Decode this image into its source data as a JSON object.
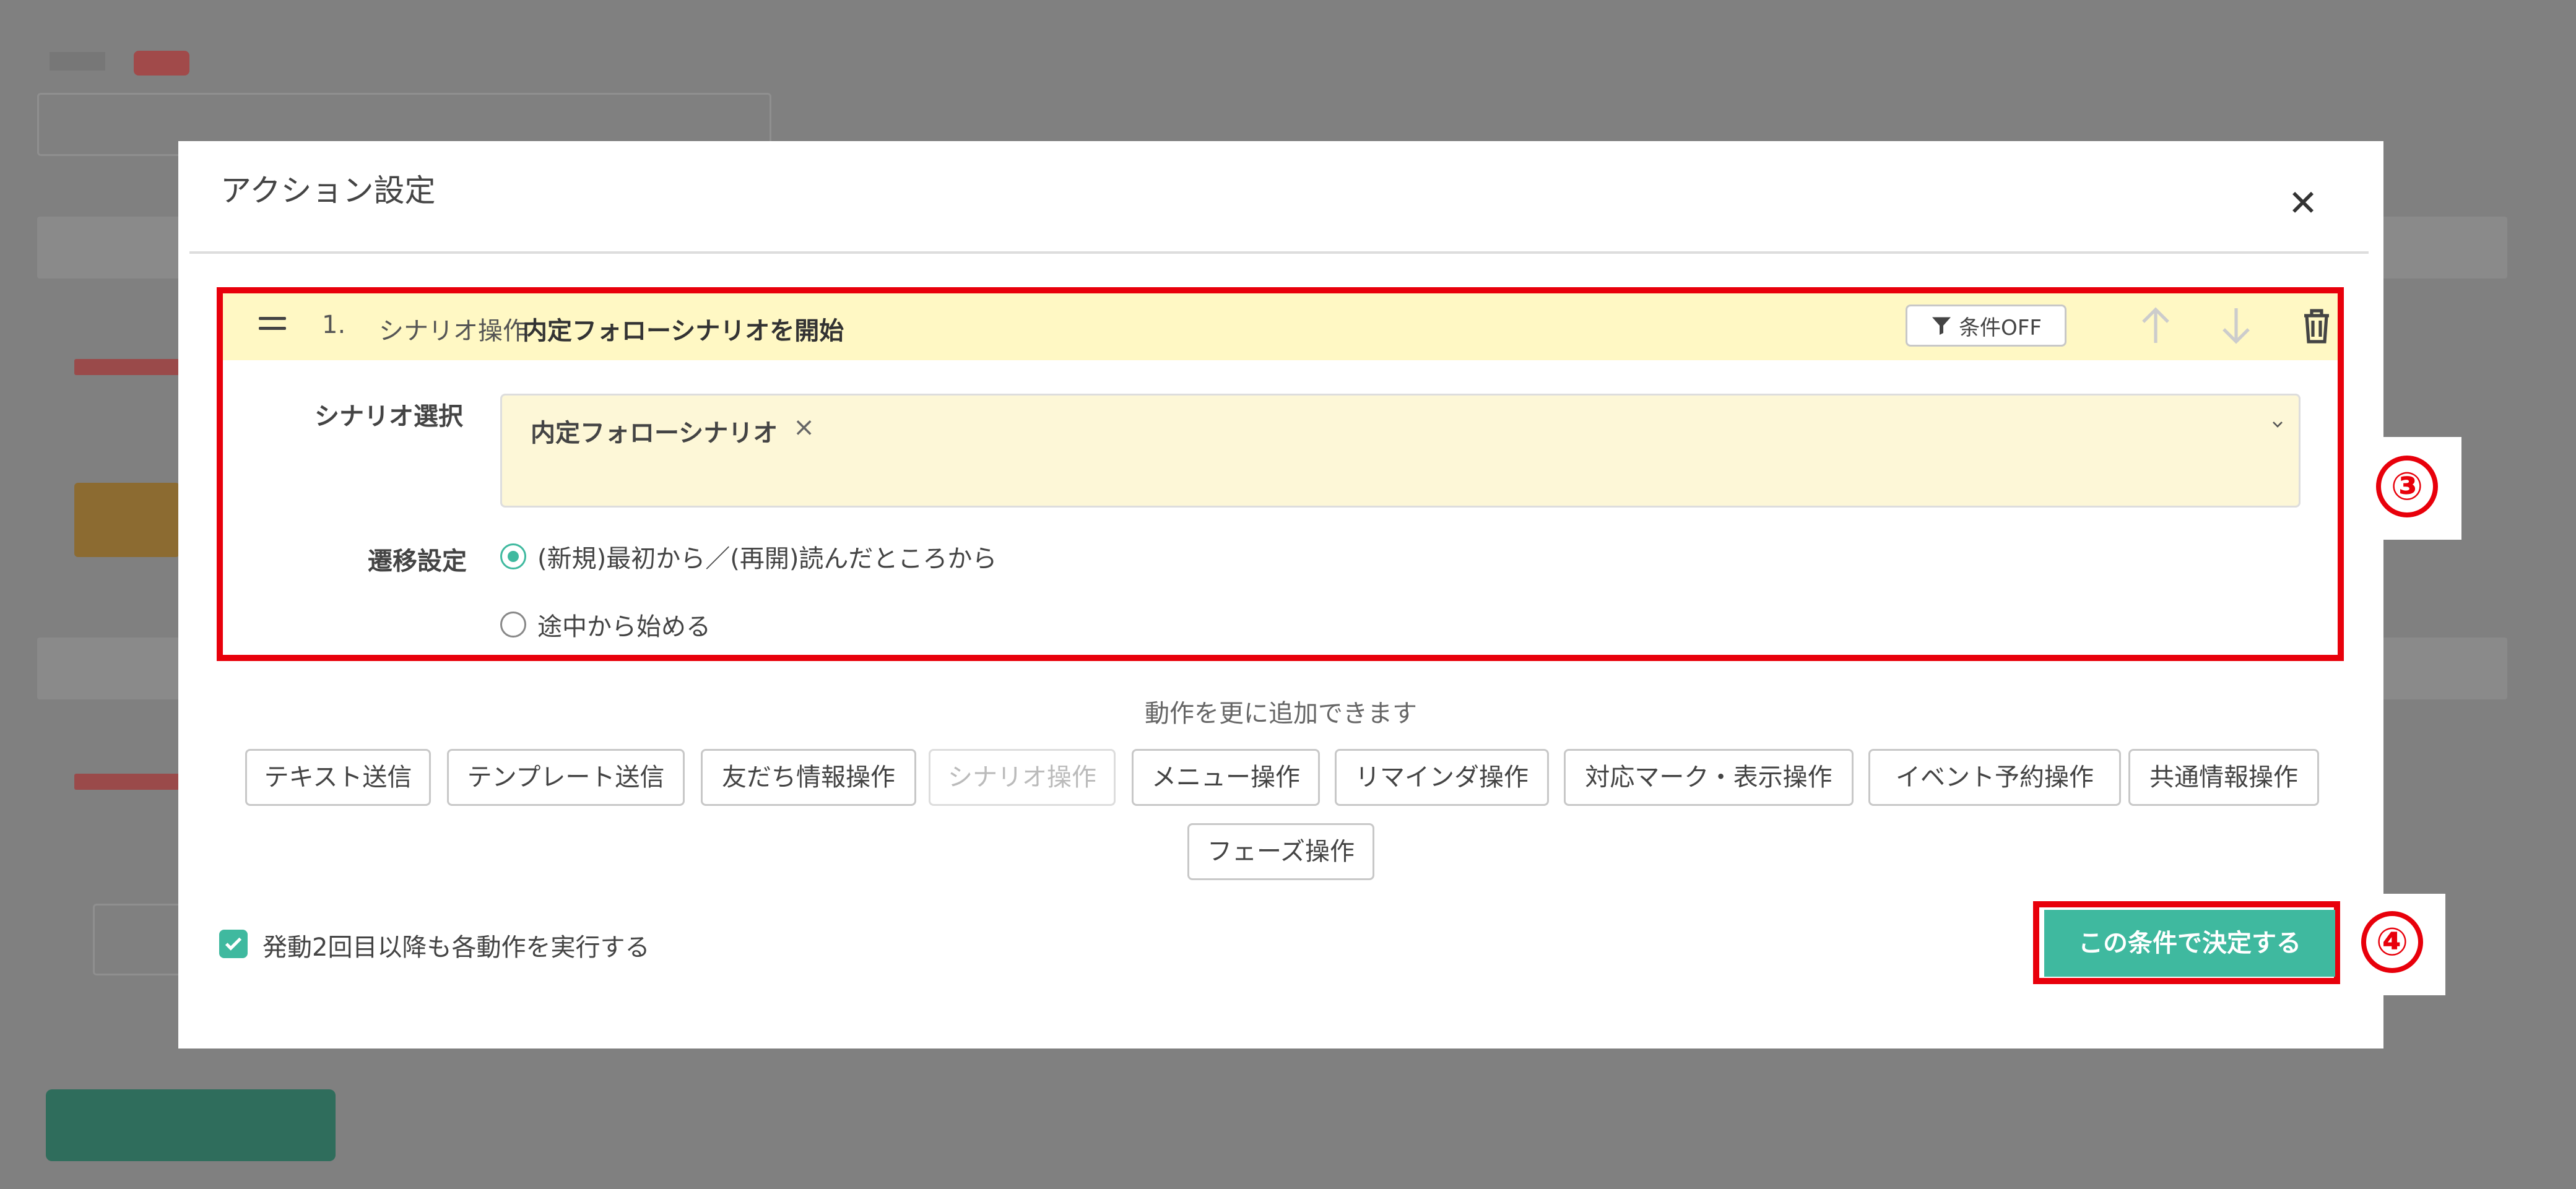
{
  "modal": {
    "title": "アクション設定",
    "close_glyph": "✕"
  },
  "action": {
    "index": "1.",
    "type": "シナリオ操作",
    "name": "内定フォローシナリオを開始",
    "condition_toggle": "条件OFF",
    "icons": [
      "drag-handle-icon",
      "filter-icon",
      "arrow-up-icon",
      "arrow-down-icon",
      "trash-icon"
    ],
    "scenario_label": "シナリオ選択",
    "scenario_value": "内定フォローシナリオ",
    "scenario_remove": "×",
    "transition_label": "遷移設定",
    "transition_options": [
      {
        "label": "(新規)最初から／(再開)読んだところから",
        "selected": true
      },
      {
        "label": "途中から始める",
        "selected": false
      }
    ]
  },
  "add_section": {
    "hint": "動作を更に追加できます",
    "buttons": [
      {
        "label": "テキスト送信",
        "disabled": false
      },
      {
        "label": "テンプレート送信",
        "disabled": false
      },
      {
        "label": "友だち情報操作",
        "disabled": false
      },
      {
        "label": "シナリオ操作",
        "disabled": true
      },
      {
        "label": "メニュー操作",
        "disabled": false
      },
      {
        "label": "リマインダ操作",
        "disabled": false
      },
      {
        "label": "対応マーク・表示操作",
        "disabled": false
      },
      {
        "label": "イベント予約操作",
        "disabled": false
      },
      {
        "label": "共通情報操作",
        "disabled": false
      },
      {
        "label": "フェーズ操作",
        "disabled": false
      }
    ]
  },
  "footer": {
    "repeat_checked": true,
    "repeat_label": "発動2回目以降も各動作を実行する",
    "confirm_label": "この条件で決定する"
  },
  "callouts": {
    "three": "③",
    "four": "④"
  },
  "colors": {
    "accent": "#3fb99f",
    "highlight": "#e8000b",
    "header_bg": "#fff8c4",
    "overlay": "#808080"
  }
}
